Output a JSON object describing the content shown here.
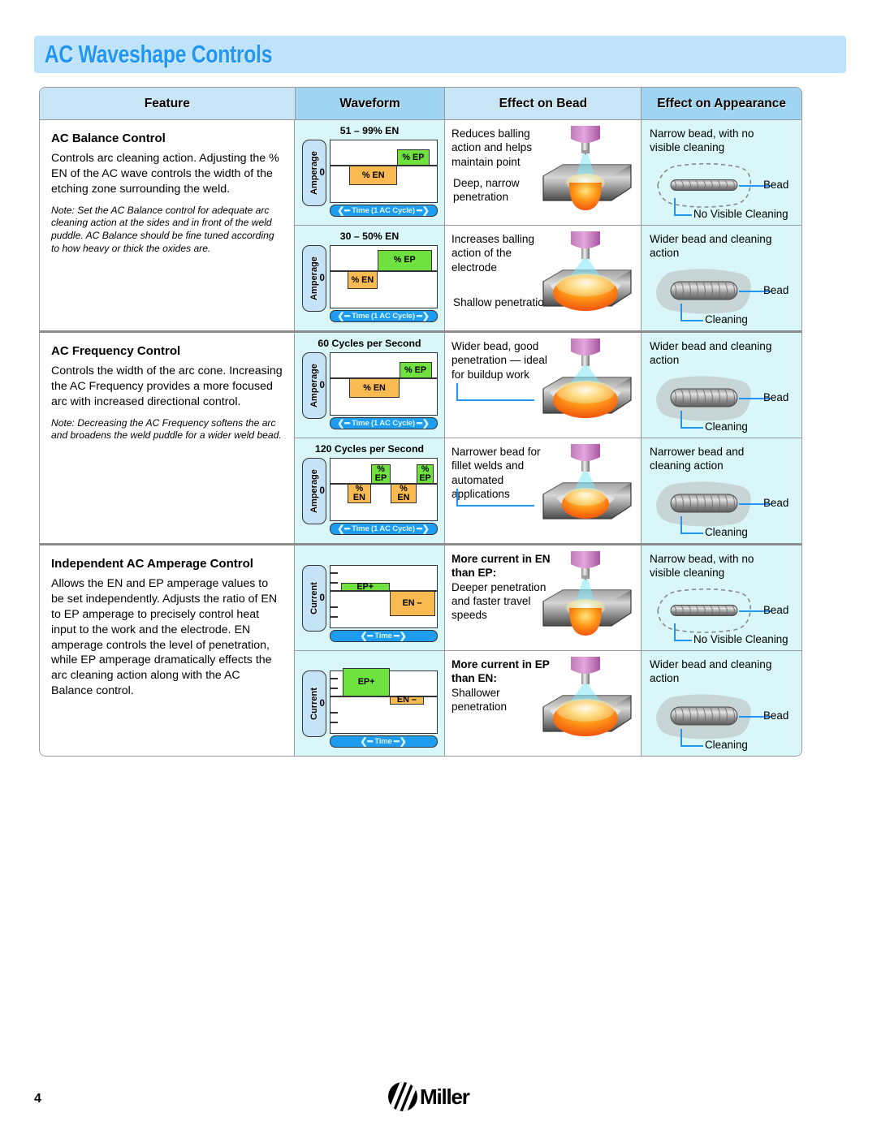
{
  "header": {
    "title": "AC Waveshape Controls"
  },
  "table": {
    "columns": [
      {
        "label": "Feature"
      },
      {
        "label": "Waveform"
      },
      {
        "label": "Effect on Bead"
      },
      {
        "label": "Effect on Appearance"
      }
    ]
  },
  "sections": [
    {
      "feature": {
        "title": "AC Balance Control",
        "body": "Controls arc cleaning action. Adjusting the % EN of the AC wave controls the width of the etching zone surrounding the weld.",
        "note": "Note: Set the AC Balance control for adequate arc cleaning action at the sides and in front of the weld puddle. AC Balance should be fine tuned according to how heavy or thick the oxides are."
      },
      "rows": [
        {
          "waveform": {
            "title": "51 – 99% EN",
            "axis_label": "Amperage",
            "zero_label": "0",
            "time_label": "Time (1 AC Cycle)",
            "ep_label": "% EP",
            "en_label": "% EN",
            "ticks": false
          },
          "bead": {
            "caption_top": "Reduces balling action and helps maintain point",
            "caption_bottom": "Deep, narrow penetration",
            "puddle": "narrow-deep"
          },
          "appearance": {
            "caption": "Narrow bead, with no visible cleaning",
            "bead_label": "Bead",
            "cleaning_label": "No Visible Cleaning",
            "cleaning": "none"
          }
        },
        {
          "waveform": {
            "title": "30 – 50% EN",
            "axis_label": "Amperage",
            "zero_label": "0",
            "time_label": "Time (1 AC Cycle)",
            "ep_label": "% EP",
            "en_label": "% EN",
            "ticks": false
          },
          "bead": {
            "caption_top": "Increases balling action of the electrode",
            "caption_bottom": "Shallow penetration",
            "puddle": "wide-shallow"
          },
          "appearance": {
            "caption": "Wider bead and cleaning action",
            "bead_label": "Bead",
            "cleaning_label": "Cleaning",
            "cleaning": "halo"
          }
        }
      ]
    },
    {
      "feature": {
        "title": "AC Frequency Control",
        "body": "Controls the width of the arc cone. Increasing the AC Frequency provides a more focused arc with increased directional control.",
        "note": "Note: Decreasing the AC Frequency softens the arc and broadens the weld puddle for a wider weld bead."
      },
      "rows": [
        {
          "waveform": {
            "title": "60 Cycles per Second",
            "axis_label": "Amperage",
            "zero_label": "0",
            "time_label": "Time (1 AC Cycle)",
            "ep_label": "% EP",
            "en_label": "% EN",
            "ticks": false
          },
          "bead": {
            "caption_top": "Wider bead, good penetration — ideal for buildup work",
            "caption_bottom": "",
            "puddle": "wide-shallow"
          },
          "appearance": {
            "caption": "Wider bead and cleaning action",
            "bead_label": "Bead",
            "cleaning_label": "Cleaning",
            "cleaning": "halo"
          }
        },
        {
          "waveform": {
            "title": "120 Cycles per Second",
            "axis_label": "Amperage",
            "zero_label": "0",
            "time_label": "Time (1 AC Cycle)",
            "ep_label": "% EP",
            "en_label": "% EN",
            "ticks": false
          },
          "bead": {
            "caption_top": "Narrower bead for fillet welds and automated applications",
            "caption_bottom": "",
            "puddle": "medium-shallow"
          },
          "appearance": {
            "caption": "Narrower bead and cleaning action",
            "bead_label": "Bead",
            "cleaning_label": "Cleaning",
            "cleaning": "halo"
          }
        }
      ]
    },
    {
      "feature": {
        "title": "Independent AC Amperage Control",
        "body": "Allows the EN and EP amperage values to be set independently. Adjusts the ratio of EN to EP amperage to precisely control heat input to the work and the electrode. EN amperage controls the level of penetration, while EP amperage dramatically effects the arc cleaning action along with the AC Balance control.",
        "note": ""
      },
      "rows": [
        {
          "waveform": {
            "title": "",
            "axis_label": "Current",
            "zero_label": "0",
            "time_label": "Time",
            "ep_label": "EP+",
            "en_label": "EN –",
            "ticks": true
          },
          "bead": {
            "caption_top": "More current in EN than EP:",
            "caption_top_bold": true,
            "caption_sub": "Deeper penetration and faster travel speeds",
            "caption_bottom": "",
            "puddle": "narrow-deep"
          },
          "appearance": {
            "caption": "Narrow bead, with no visible cleaning",
            "bead_label": "Bead",
            "cleaning_label": "No Visible Cleaning",
            "cleaning": "none"
          }
        },
        {
          "waveform": {
            "title": "",
            "axis_label": "Current",
            "zero_label": "0",
            "time_label": "Time",
            "ep_label": "EP+",
            "en_label": "EN –",
            "ticks": true
          },
          "bead": {
            "caption_top": "More current in EP than EN:",
            "caption_top_bold": true,
            "caption_sub": "Shallower penetration",
            "caption_bottom": "",
            "puddle": "wide-shallow"
          },
          "appearance": {
            "caption": "Wider bead and cleaning action",
            "bead_label": "Bead",
            "cleaning_label": "Cleaning",
            "cleaning": "halo"
          }
        }
      ]
    }
  ],
  "footer": {
    "page_number": "4",
    "brand": "Miller"
  },
  "chart_data": [
    {
      "type": "bar",
      "title": "51 – 99% EN",
      "ylabel": "Amperage",
      "xlabel": "Time (1 AC Cycle)",
      "segments": [
        {
          "label": "% EN",
          "polarity": "negative",
          "x_start": 0.18,
          "x_end": 0.62,
          "amplitude": -0.55,
          "color": "#f9ba52"
        },
        {
          "label": "% EP",
          "polarity": "positive",
          "x_start": 0.62,
          "x_end": 0.92,
          "amplitude": 0.45,
          "color": "#6fe240"
        }
      ]
    },
    {
      "type": "bar",
      "title": "30 – 50% EN",
      "ylabel": "Amperage",
      "xlabel": "Time (1 AC Cycle)",
      "segments": [
        {
          "label": "% EN",
          "polarity": "negative",
          "x_start": 0.16,
          "x_end": 0.44,
          "amplitude": -0.5,
          "color": "#f9ba52"
        },
        {
          "label": "% EP",
          "polarity": "positive",
          "x_start": 0.44,
          "x_end": 0.94,
          "amplitude": 0.6,
          "color": "#6fe240"
        }
      ]
    },
    {
      "type": "bar",
      "title": "60 Cycles per Second",
      "ylabel": "Amperage",
      "xlabel": "Time (1 AC Cycle)",
      "segments": [
        {
          "label": "% EN",
          "polarity": "negative",
          "x_start": 0.18,
          "x_end": 0.64,
          "amplitude": -0.55,
          "color": "#f9ba52"
        },
        {
          "label": "% EP",
          "polarity": "positive",
          "x_start": 0.64,
          "x_end": 0.94,
          "amplitude": 0.45,
          "color": "#6fe240"
        }
      ]
    },
    {
      "type": "bar",
      "title": "120 Cycles per Second",
      "ylabel": "Amperage",
      "xlabel": "Time (1 AC Cycle)",
      "segments": [
        {
          "label": "% EN",
          "polarity": "negative",
          "x_start": 0.16,
          "x_end": 0.38,
          "amplitude": -0.55,
          "color": "#f9ba52"
        },
        {
          "label": "% EP",
          "polarity": "positive",
          "x_start": 0.38,
          "x_end": 0.56,
          "amplitude": 0.55,
          "color": "#6fe240"
        },
        {
          "label": "% EN",
          "polarity": "negative",
          "x_start": 0.56,
          "x_end": 0.8,
          "amplitude": -0.55,
          "color": "#f9ba52"
        },
        {
          "label": "% EP",
          "polarity": "positive",
          "x_start": 0.8,
          "x_end": 0.96,
          "amplitude": 0.55,
          "color": "#6fe240"
        }
      ]
    },
    {
      "type": "bar",
      "title": "More current in EN than EP",
      "ylabel": "Current",
      "xlabel": "Time",
      "segments": [
        {
          "label": "EP+",
          "polarity": "positive",
          "x_start": 0.1,
          "x_end": 0.55,
          "amplitude": 0.22,
          "color": "#6fe240"
        },
        {
          "label": "EN –",
          "polarity": "negative",
          "x_start": 0.55,
          "x_end": 0.97,
          "amplitude": -0.7,
          "color": "#f9ba52"
        }
      ]
    },
    {
      "type": "bar",
      "title": "More current in EP than EN",
      "ylabel": "Current",
      "xlabel": "Time",
      "segments": [
        {
          "label": "EP+",
          "polarity": "positive",
          "x_start": 0.12,
          "x_end": 0.55,
          "amplitude": 0.8,
          "color": "#6fe240"
        },
        {
          "label": "EN –",
          "polarity": "negative",
          "x_start": 0.55,
          "x_end": 0.87,
          "amplitude": -0.22,
          "color": "#f9ba52"
        }
      ]
    }
  ]
}
